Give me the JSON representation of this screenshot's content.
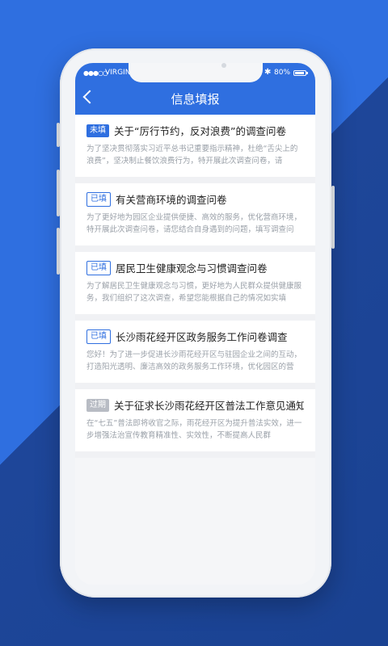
{
  "status": {
    "carrier": "VIRGIN",
    "signal": "●●●○○",
    "battery_text": "80%"
  },
  "nav": {
    "title": "信息填报"
  },
  "items": [
    {
      "tag": "未填",
      "title": "关于“厉行节约，反对浪费”的调查问卷",
      "desc": "为了坚决贯彻落实习近平总书记重要指示精神，杜绝“舌尖上的浪费”，坚决制止餐饮浪费行为，特开展此次调查问卷，请"
    },
    {
      "tag": "已填",
      "title": "有关营商环境的调查问卷",
      "desc": "为了更好地为园区企业提供便捷、高效的服务，优化营商环境，特开展此次调查问卷，请您结合自身遇到的问题，填写调查问"
    },
    {
      "tag": "已填",
      "title": "居民卫生健康观念与习惯调查问卷",
      "desc": "为了解居民卫生健康观念与习惯，更好地为人民群众提供健康服务，我们组织了这次调查，希望您能根据自己的情况如实填"
    },
    {
      "tag": "已填",
      "title": "长沙雨花经开区政务服务工作问卷调查",
      "desc": "您好！为了进一步促进长沙雨花经开区与驻园企业之间的互动，打造阳光透明、廉洁高效的政务服务工作环境，优化园区的营"
    },
    {
      "tag": "过期",
      "title": "关于征求长沙雨花经开区普法工作意见通知",
      "desc": "在“七五”普法即将收官之际，雨花经开区为提升普法实效，进一步增强法治宣传教育精准性、实效性，不断提高人民群"
    }
  ],
  "colors": {
    "brand": "#2f6fe0",
    "expired": "#b8bcc4"
  }
}
